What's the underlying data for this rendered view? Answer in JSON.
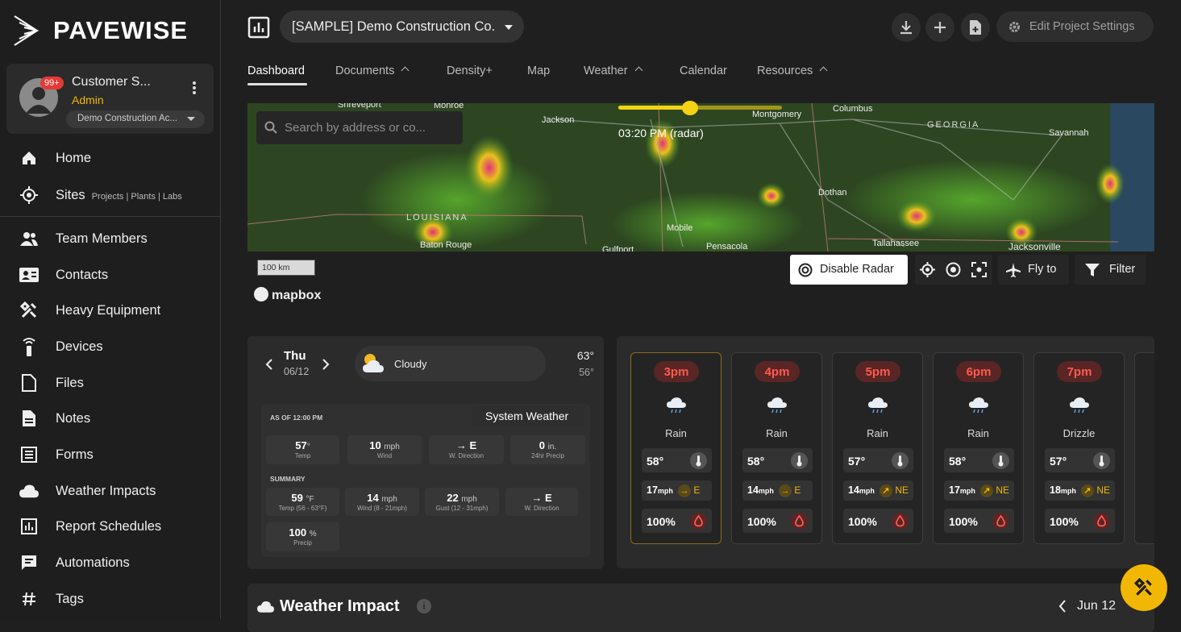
{
  "brand": {
    "name": "PAVEWISE"
  },
  "profile": {
    "badge": "99+",
    "name": "Customer S...",
    "role": "Admin",
    "org": "Demo Construction Ac..."
  },
  "sidebar": {
    "items": [
      {
        "label": "Home",
        "icon": "home-icon"
      },
      {
        "label": "Sites",
        "sub": "Projects | Plants | Labs",
        "icon": "target-icon"
      },
      {
        "label": "Team Members",
        "icon": "people-icon"
      },
      {
        "label": "Contacts",
        "icon": "contact-card-icon"
      },
      {
        "label": "Heavy Equipment",
        "icon": "tools-icon"
      },
      {
        "label": "Devices",
        "icon": "device-icon"
      },
      {
        "label": "Files",
        "icon": "file-icon"
      },
      {
        "label": "Notes",
        "icon": "note-icon"
      },
      {
        "label": "Forms",
        "icon": "form-icon"
      },
      {
        "label": "Weather Impacts",
        "icon": "cloud-icon"
      },
      {
        "label": "Report Schedules",
        "icon": "report-icon"
      },
      {
        "label": "Automations",
        "icon": "chat-icon"
      },
      {
        "label": "Tags",
        "icon": "hash-icon"
      }
    ]
  },
  "header": {
    "project": "[SAMPLE] Demo Construction Co.",
    "edit_label": "Edit Project Settings"
  },
  "tabs": [
    "Dashboard",
    "Documents",
    "Density+",
    "Map",
    "Weather",
    "Calendar",
    "Resources"
  ],
  "map": {
    "search_placeholder": "Search by address or co...",
    "radar_time": "03:20 PM (radar)",
    "radar_progress": 0.44,
    "scale": "100 km",
    "attribution": "mapbox",
    "disable_radar": "Disable Radar",
    "fly_to": "Fly to",
    "filter": "Filter",
    "places": [
      "Shreveport",
      "Monroe",
      "Jackson",
      "Montgomery",
      "Columbus",
      "GEORGIA",
      "Savannah",
      "LOUISIANA",
      "Dothan",
      "Mobile",
      "Baton Rouge",
      "Gulfport",
      "Pensacola",
      "Tallahassee",
      "Jacksonville"
    ]
  },
  "weather_day": {
    "day": "Thu",
    "date": "06/12",
    "condition": "Cloudy",
    "high": "63°",
    "low": "56°",
    "as_of": "AS OF 12:00 PM",
    "source": "System Weather",
    "current": [
      {
        "value": "57",
        "unit": "°",
        "label": "Temp"
      },
      {
        "value": "10",
        "unit": "mph",
        "label": "Wind"
      },
      {
        "value": "→ E",
        "unit": "",
        "label": "W. Direction"
      },
      {
        "value": "0",
        "unit": "in.",
        "label": "24hr Precip"
      }
    ],
    "summary_label": "SUMMARY",
    "summary": [
      {
        "value": "59",
        "unit": "°F",
        "label": "Temp (56 - 63°F)"
      },
      {
        "value": "14",
        "unit": "mph",
        "label": "Wind (8 - 21mph)"
      },
      {
        "value": "22",
        "unit": "mph",
        "label": "Gust (12 - 31mph)"
      },
      {
        "value": "→ E",
        "unit": "",
        "label": "W. Direction"
      },
      {
        "value": "100",
        "unit": "%",
        "label": "Precip"
      }
    ]
  },
  "hourly": [
    {
      "time": "3pm",
      "cond": "Rain",
      "temp": "58°",
      "wind": "17",
      "dir": "E",
      "precip": "100%"
    },
    {
      "time": "4pm",
      "cond": "Rain",
      "temp": "58°",
      "wind": "14",
      "dir": "E",
      "precip": "100%"
    },
    {
      "time": "5pm",
      "cond": "Rain",
      "temp": "57°",
      "wind": "14",
      "dir": "NE",
      "precip": "100%"
    },
    {
      "time": "6pm",
      "cond": "Rain",
      "temp": "58°",
      "wind": "17",
      "dir": "NE",
      "precip": "100%"
    },
    {
      "time": "7pm",
      "cond": "Drizzle",
      "temp": "57°",
      "wind": "18",
      "dir": "NE",
      "precip": "100%"
    }
  ],
  "wind_unit": "mph",
  "impact": {
    "title": "Weather Impact",
    "date": "Jun 12"
  },
  "colors": {
    "accent": "#f2b705",
    "badge": "#e53935",
    "time": "#ff5a4e"
  }
}
